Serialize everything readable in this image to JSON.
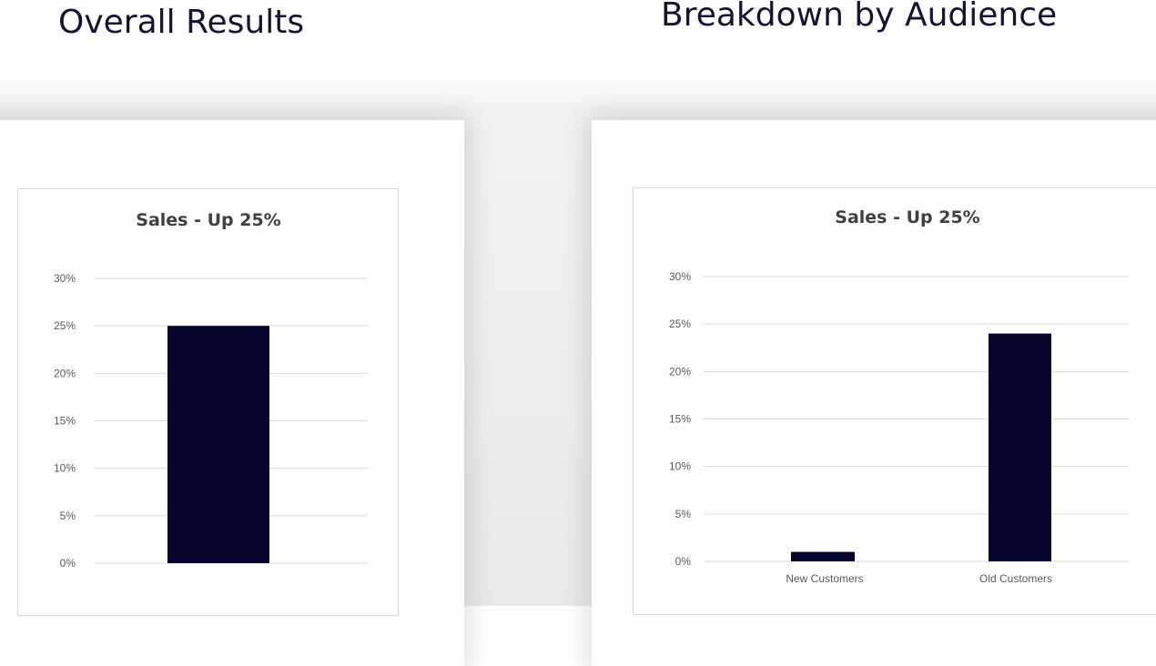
{
  "headings": {
    "left": "Overall Results",
    "right": "Breakdown by Audience"
  },
  "colors": {
    "bar": "#06052e",
    "heading": "#141433"
  },
  "chart_data": [
    {
      "type": "bar",
      "title": "Sales - Up 25%",
      "categories": [
        ""
      ],
      "values": [
        25
      ],
      "ylim": [
        0,
        30
      ],
      "yticks": [
        "0%",
        "5%",
        "10%",
        "15%",
        "20%",
        "25%",
        "30%"
      ],
      "grid": true,
      "legend": "none"
    },
    {
      "type": "bar",
      "title": "Sales - Up 25%",
      "categories": [
        "New Customers",
        "Old Customers"
      ],
      "values": [
        1,
        24
      ],
      "ylim": [
        0,
        30
      ],
      "yticks": [
        "0%",
        "5%",
        "10%",
        "15%",
        "20%",
        "25%",
        "30%"
      ],
      "grid": true,
      "legend": "none"
    }
  ]
}
